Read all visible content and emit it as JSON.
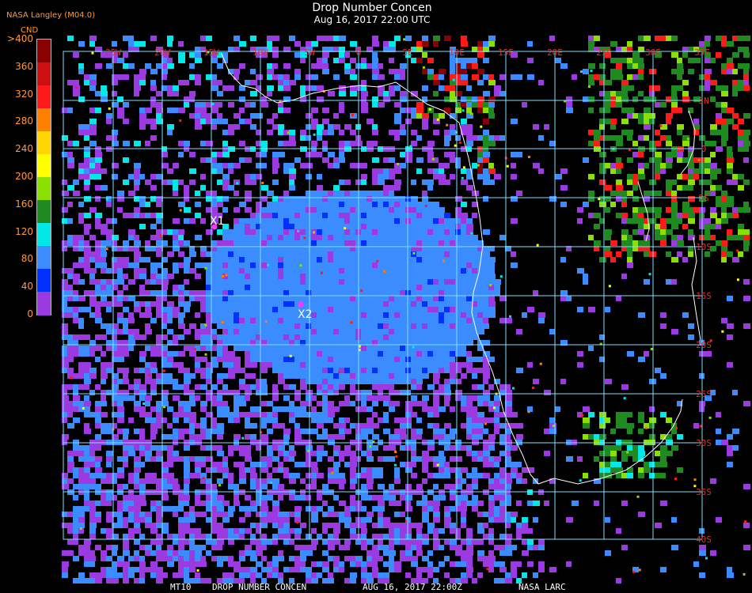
{
  "header": {
    "org": "NASA Langley (M04.0)",
    "title": "Drop Number Concen",
    "subtitle": "Aug 16, 2017 22:00 UTC"
  },
  "legend": {
    "unit": "CND",
    "ticks": [
      ">400",
      "360",
      "320",
      "280",
      "240",
      "200",
      "160",
      "120",
      "80",
      "40",
      "0"
    ],
    "colors": [
      "#8b0000",
      "#cc1010",
      "#ff1a1a",
      "#ff7f00",
      "#ffd400",
      "#ffff00",
      "#8ce000",
      "#1f8a1f",
      "#00e8e8",
      "#3a8cff",
      "#0030ff",
      "#9a3ae0"
    ]
  },
  "map": {
    "lon_labels": [
      "25W",
      "20W",
      "15W",
      "10W",
      "5W",
      "0",
      "5E",
      "10E",
      "15E",
      "20E",
      "25E",
      "30E",
      "35E"
    ],
    "lat_labels": [
      "5N",
      "0",
      "5S",
      "10S",
      "15S",
      "20S",
      "25S",
      "30S",
      "35S",
      "40S"
    ],
    "grid_color": "#7fe0ff",
    "coast_color": "#ffffff",
    "markers": [
      {
        "label": "X1",
        "color": "#ff33ff"
      },
      {
        "label": "X2",
        "color": "#ff33ff"
      }
    ]
  },
  "footer": {
    "product": "MT10",
    "name": "DROP NUMBER CONCEN",
    "datetime": "AUG 16, 2017 22:00Z",
    "source": "NASA LARC"
  }
}
